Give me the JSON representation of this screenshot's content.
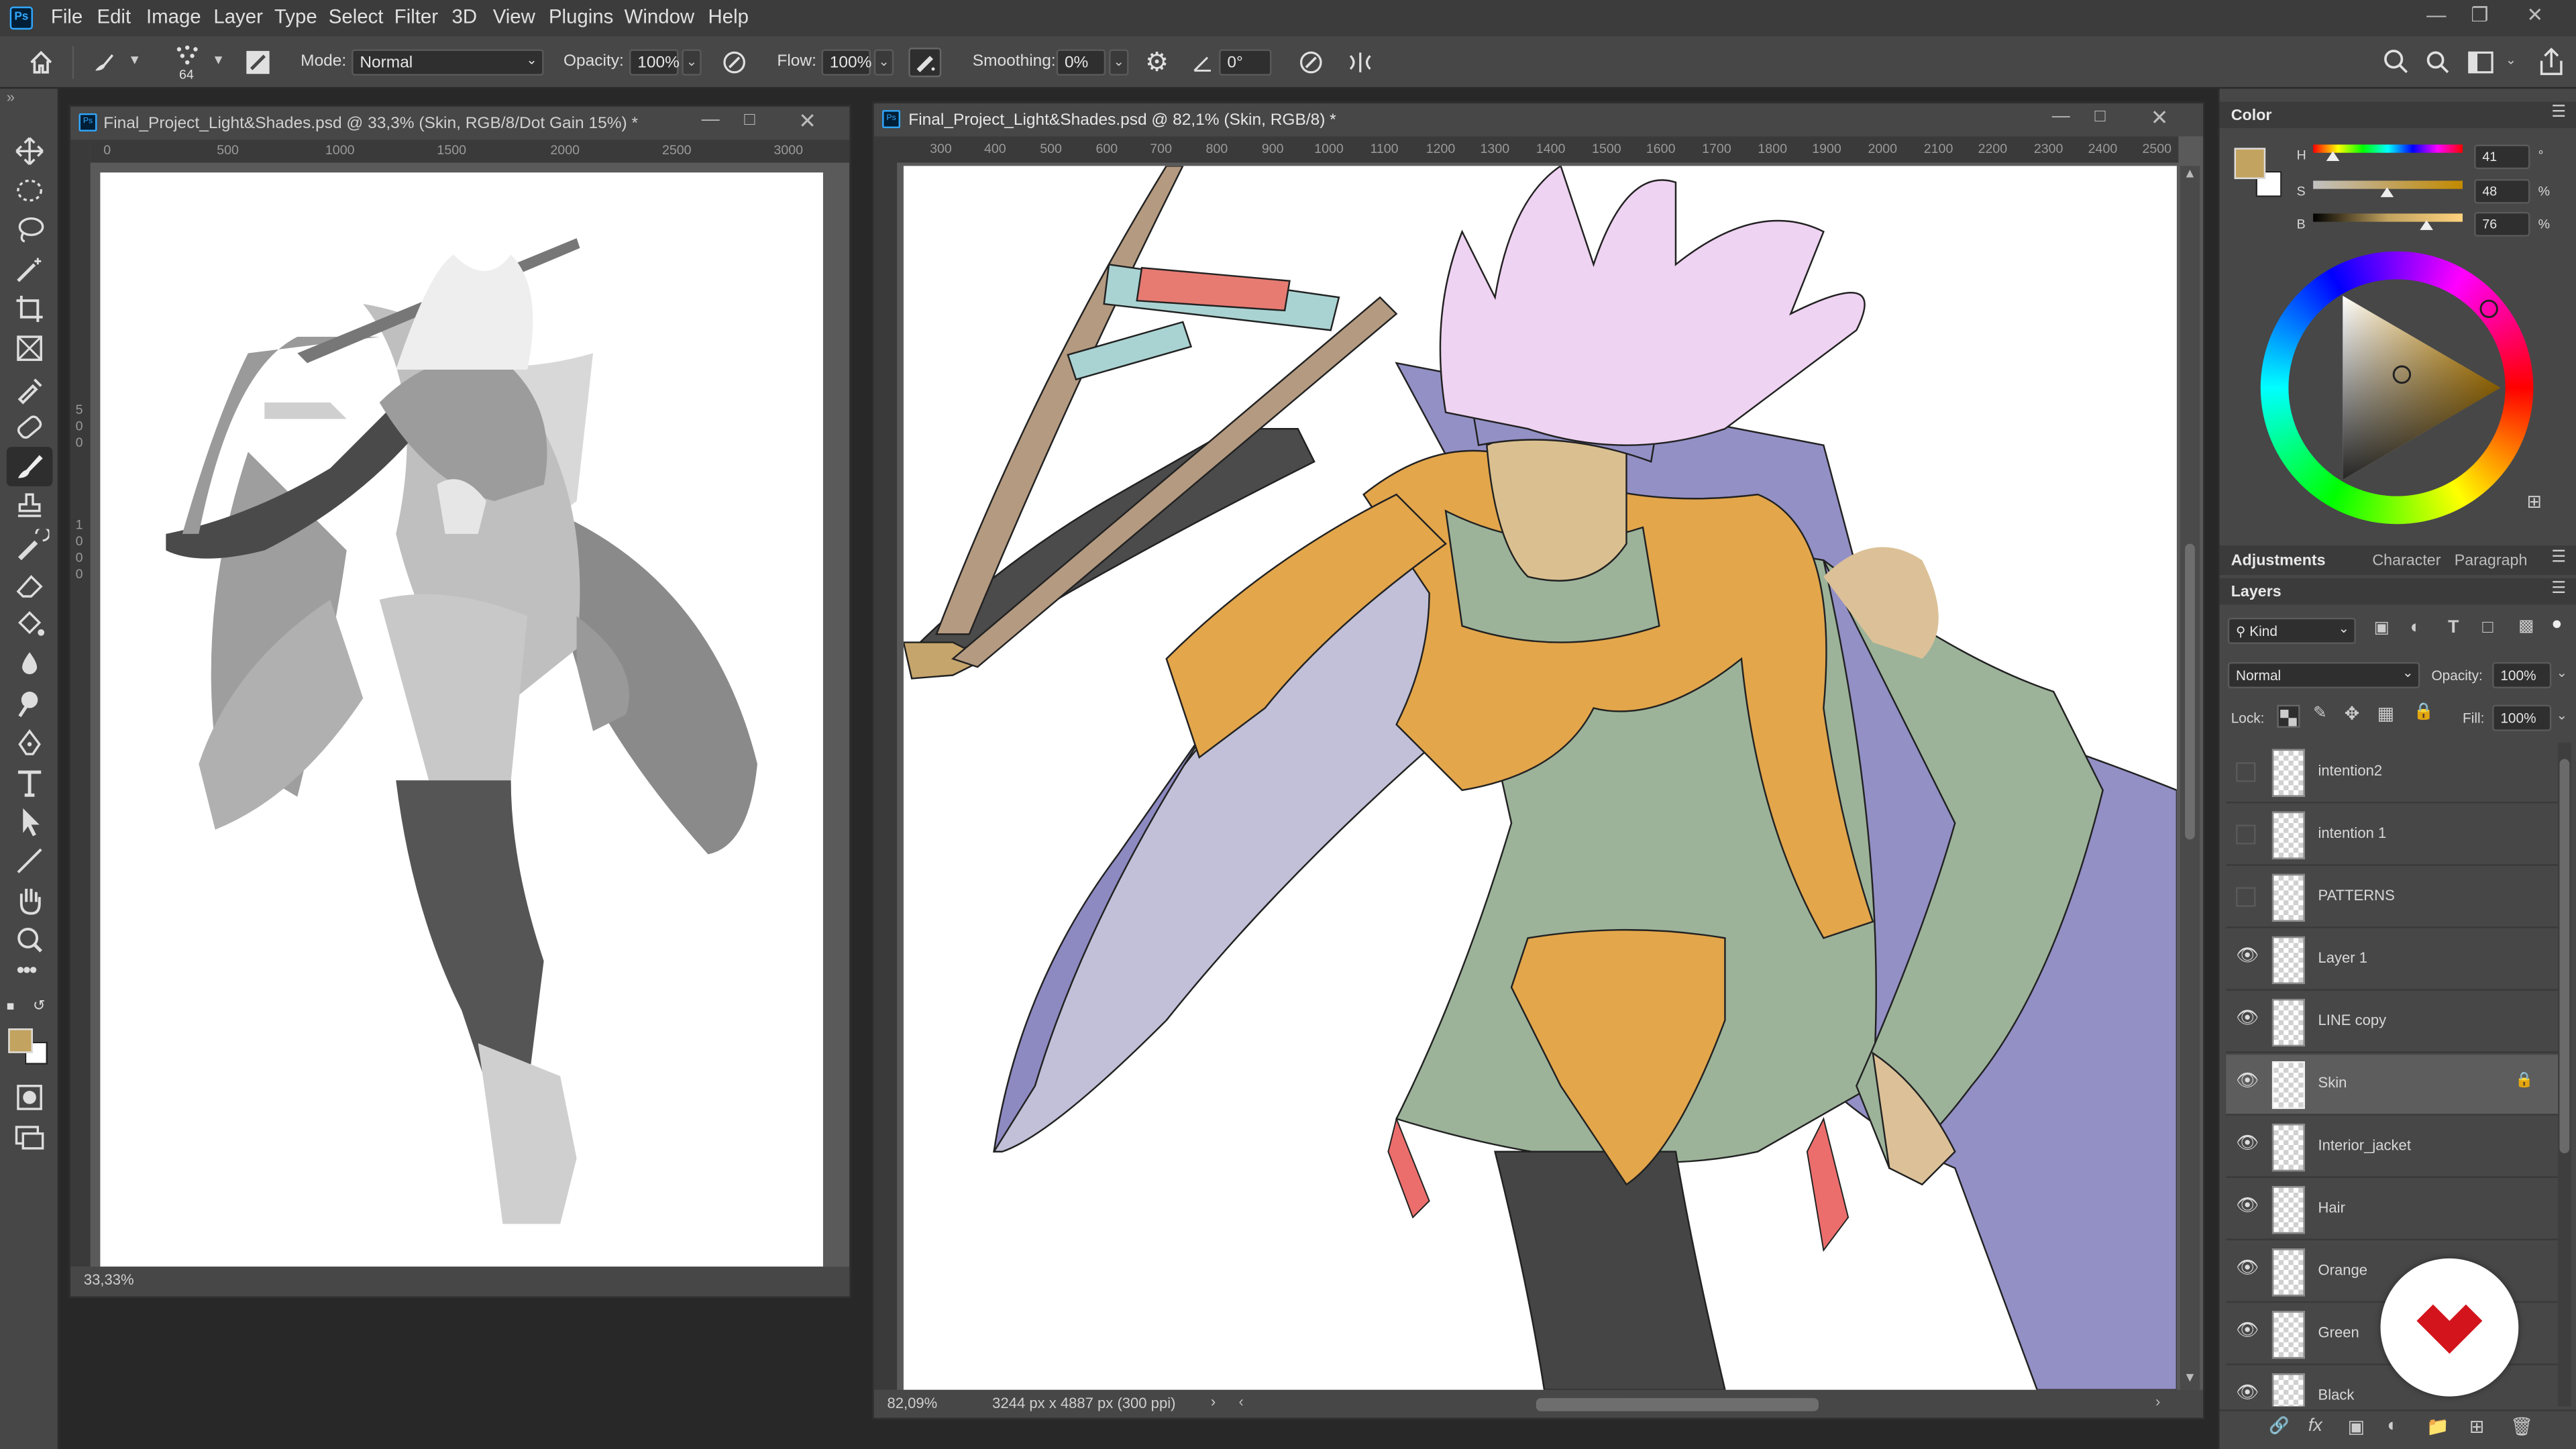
{
  "menu": {
    "app_logo": "Ps",
    "items": [
      "File",
      "Edit",
      "Image",
      "Layer",
      "Type",
      "Select",
      "Filter",
      "3D",
      "View",
      "Plugins",
      "Window",
      "Help"
    ]
  },
  "options": {
    "brush_size": "64",
    "mode_label": "Mode:",
    "mode_value": "Normal",
    "opacity_label": "Opacity:",
    "opacity_value": "100%",
    "flow_label": "Flow:",
    "flow_value": "100%",
    "smoothing_label": "Smoothing:",
    "smoothing_value": "0%",
    "angle_value": "0°"
  },
  "doc_left": {
    "title": "Final_Project_Light&Shades.psd @ 33,3% (Skin, RGB/8/Dot Gain 15%) *",
    "ruler": [
      "0",
      "500",
      "1000",
      "1500",
      "2000",
      "2500",
      "3000"
    ],
    "vruler": [
      "5",
      "0",
      "0",
      "1",
      "0",
      "0",
      "0"
    ],
    "zoom": "33,33%"
  },
  "doc_right": {
    "title": "Final_Project_Light&Shades.psd @ 82,1% (Skin, RGB/8) *",
    "ruler": [
      "300",
      "400",
      "500",
      "600",
      "700",
      "800",
      "900",
      "1000",
      "1100",
      "1200",
      "1300",
      "1400",
      "1500",
      "1600",
      "1700",
      "1800",
      "1900",
      "2000",
      "2100",
      "2200",
      "2300",
      "2400",
      "2500"
    ],
    "zoom": "82,09%",
    "doc_info": "3244 px x 4887 px (300 ppi)"
  },
  "color_panel": {
    "title": "Color",
    "h_label": "H",
    "h_value": "41",
    "h_unit": "°",
    "s_label": "S",
    "s_value": "48",
    "s_unit": "%",
    "b_label": "B",
    "b_value": "76",
    "b_unit": "%",
    "fg_color": "#c2a35f"
  },
  "tabs": [
    "Adjustments",
    "Character",
    "Paragraph"
  ],
  "layers_panel": {
    "title": "Layers",
    "kind_label": "Kind",
    "blend_mode": "Normal",
    "opacity_label": "Opacity:",
    "opacity_value": "100%",
    "lock_label": "Lock:",
    "fill_label": "Fill:",
    "fill_value": "100%",
    "layers": [
      {
        "name": "intention2",
        "visible": false
      },
      {
        "name": "intention 1",
        "visible": false
      },
      {
        "name": "PATTERNS",
        "visible": false
      },
      {
        "name": "Layer 1",
        "visible": true
      },
      {
        "name": "LINE copy",
        "visible": true
      },
      {
        "name": "Skin",
        "visible": true,
        "selected": true,
        "locked": true
      },
      {
        "name": "Interior_jacket",
        "visible": true
      },
      {
        "name": "Hair",
        "visible": true
      },
      {
        "name": "Orange",
        "visible": true
      },
      {
        "name": "Green",
        "visible": true
      },
      {
        "name": "Black",
        "visible": true
      }
    ]
  }
}
